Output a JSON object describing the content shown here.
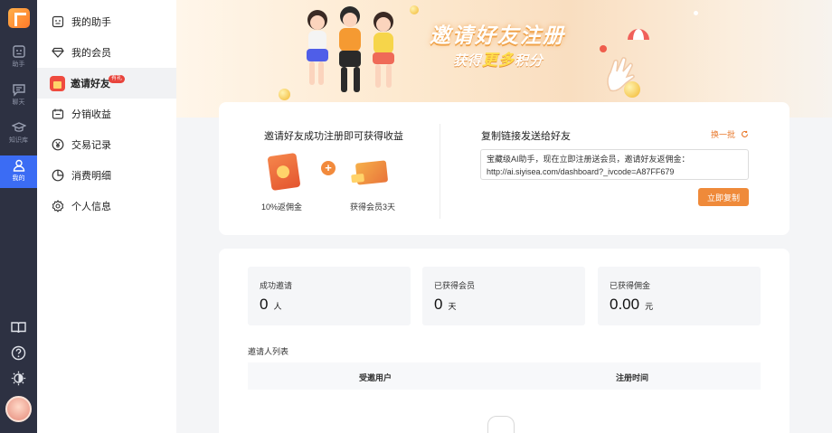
{
  "rail": {
    "items": [
      {
        "label": "助手",
        "icon": "assistant-icon"
      },
      {
        "label": "聊天",
        "icon": "chat-icon"
      },
      {
        "label": "知识库",
        "icon": "knowledge-icon"
      },
      {
        "label": "我的",
        "icon": "user-icon",
        "active": true
      }
    ],
    "bottom_icons": [
      "book-icon",
      "help-icon",
      "theme-toggle-icon"
    ]
  },
  "menu": {
    "items": [
      {
        "label": "我的助手",
        "icon": "assistant-icon"
      },
      {
        "label": "我的会员",
        "icon": "diamond-icon"
      },
      {
        "label": "邀请好友",
        "icon": "gift-icon",
        "badge": "有礼",
        "active": true
      },
      {
        "label": "分销收益",
        "icon": "wallet-icon"
      },
      {
        "label": "交易记录",
        "icon": "yen-icon"
      },
      {
        "label": "消费明细",
        "icon": "pie-icon"
      },
      {
        "label": "个人信息",
        "icon": "gear-icon"
      }
    ]
  },
  "banner": {
    "title": "邀请好友注册",
    "sub_pre": "获得",
    "sub_highlight": "更多",
    "sub_post": "积分"
  },
  "invite_card": {
    "left_title": "邀请好友成功注册即可获得收益",
    "reward1": "10%返佣金",
    "reward2": "获得会员3天",
    "right_title": "复制链接发送给好友",
    "swap_label": "换一批",
    "link_line1": "宝藏级AI助手，现在立即注册送会员，邀请好友返佣金：",
    "link_line2": "http://ai.siyisea.com/dashboard?_ivcode=A87FF679",
    "copy_button": "立即复制"
  },
  "stats": [
    {
      "label": "成功邀请",
      "value": "0",
      "unit": "人"
    },
    {
      "label": "已获得会员",
      "value": "0",
      "unit": "天"
    },
    {
      "label": "已获得佣金",
      "value": "0.00",
      "unit": "元"
    }
  ],
  "invite_list": {
    "label": "邀请人列表",
    "columns": [
      "受邀用户",
      "注册时间"
    ]
  },
  "colors": {
    "accent": "#ef8a3a",
    "rail_bg": "#2d3142",
    "rail_active": "#3b6cf4"
  }
}
